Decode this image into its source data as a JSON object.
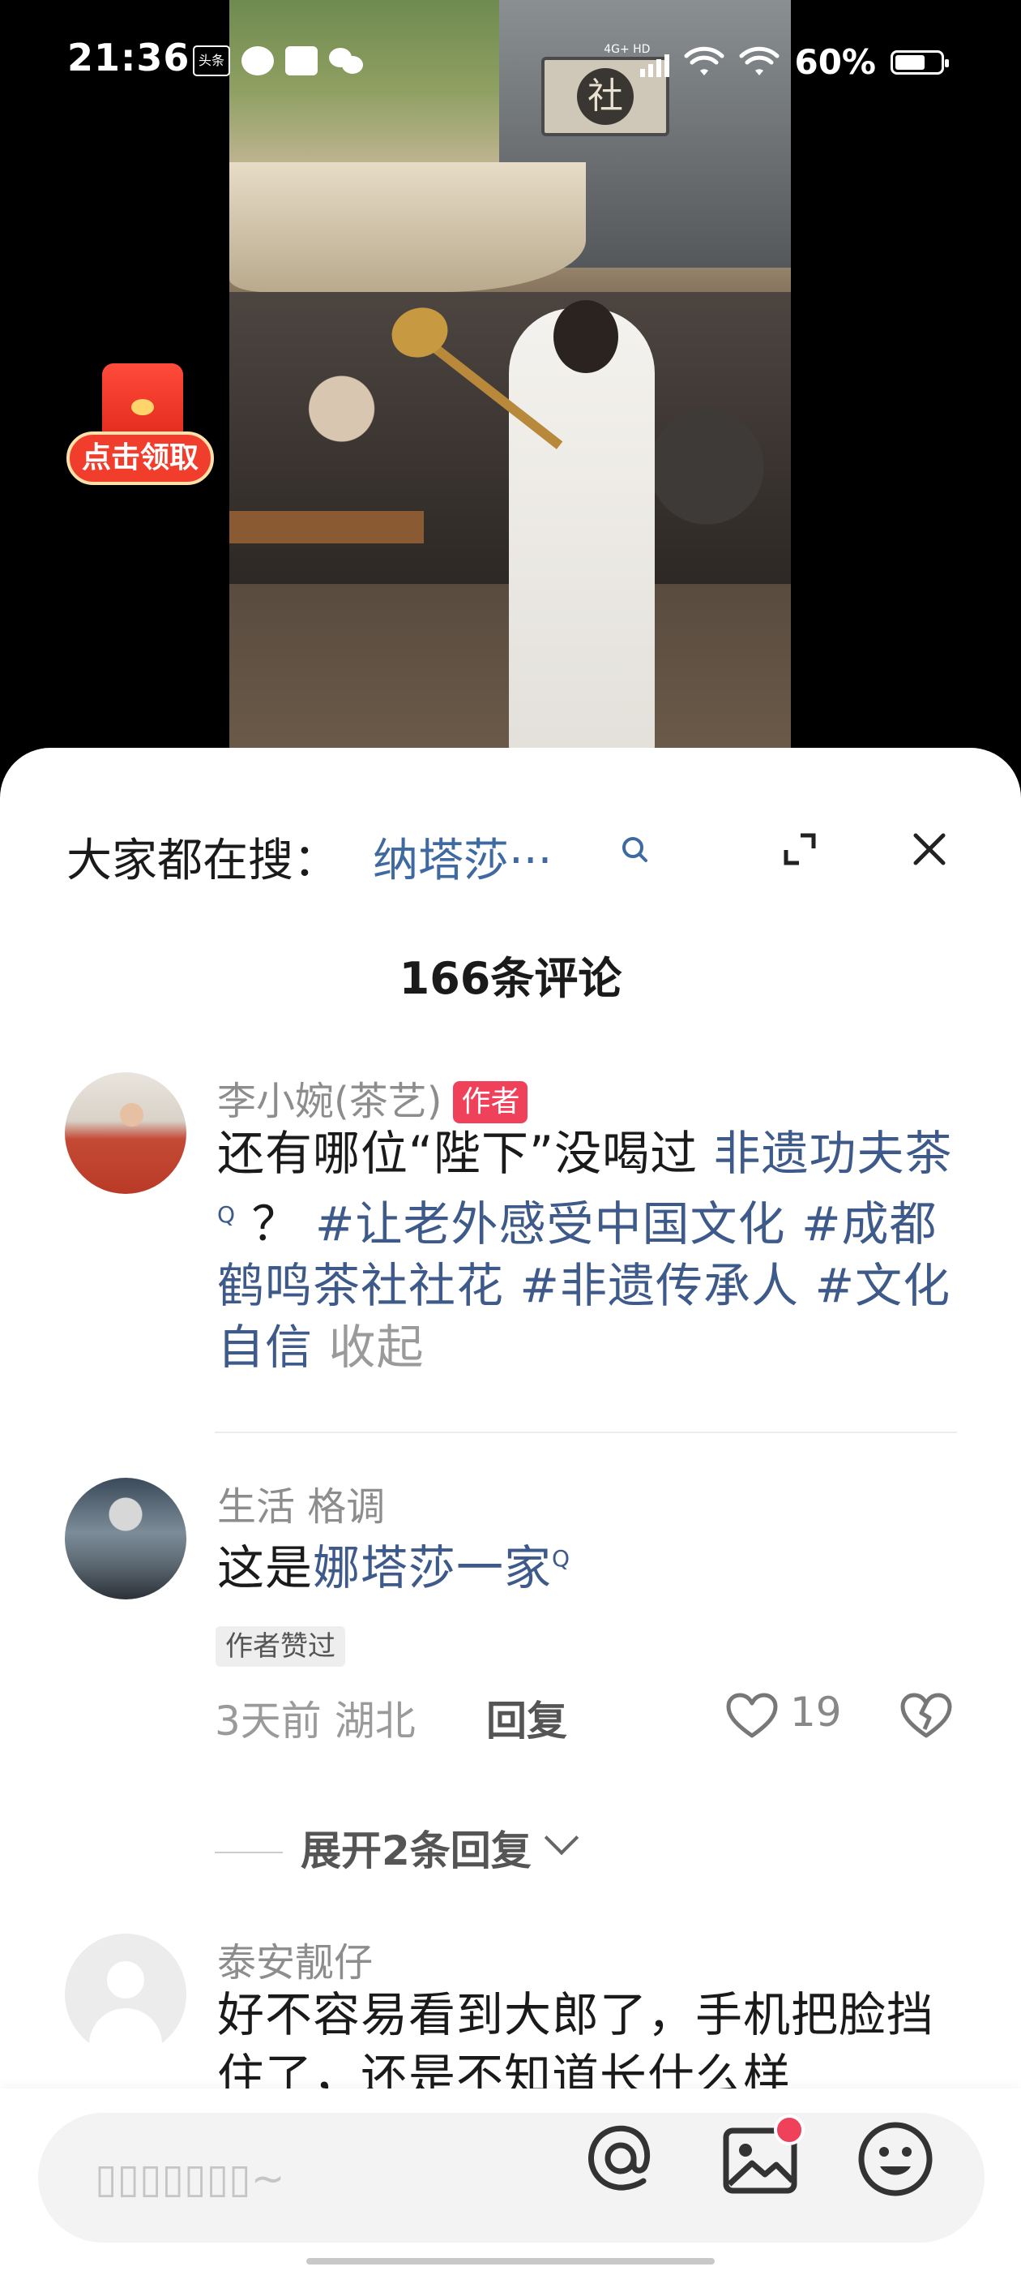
{
  "status_bar": {
    "time": "21:36",
    "app_icon_label": "头条",
    "network_label": "4G+ HD",
    "battery_percent": "60%"
  },
  "video": {
    "sign_char": "社"
  },
  "red_packet": {
    "label": "点击领取"
  },
  "search": {
    "prefix": "大家都在搜：",
    "term": "纳塔莎···"
  },
  "comments_header": {
    "count_label": "166条评论"
  },
  "comments": [
    {
      "name": "李小婉(茶艺)",
      "badge": "作者",
      "text_intro": "还有哪位“陛下”没喝过 ",
      "link1": "非遗功夫茶",
      "text_mid": "？ ",
      "tags": "#让老外感受中国文化 #成都鹤鸣茶社社花 #非遗传承人 #文化自信",
      "collapse": "收起"
    },
    {
      "name": "生活 格调",
      "text_prefix": "这是",
      "link": "娜塔莎一家",
      "liked_badge": "作者赞过",
      "time_location": "3天前 湖北",
      "reply_label": "回复",
      "like_count": "19",
      "expand_label": "展开2条回复"
    },
    {
      "name": "泰安靓仔",
      "text": "好不容易看到大郎了，手机把脸挡住了，还是不知道长什么样"
    }
  ],
  "input": {
    "placeholder": "▯▯▯▯▯▯▯~"
  },
  "colors": {
    "link": "#3e5a8a",
    "author_badge": "#f0415b",
    "red_packet": "#f13d2c"
  }
}
